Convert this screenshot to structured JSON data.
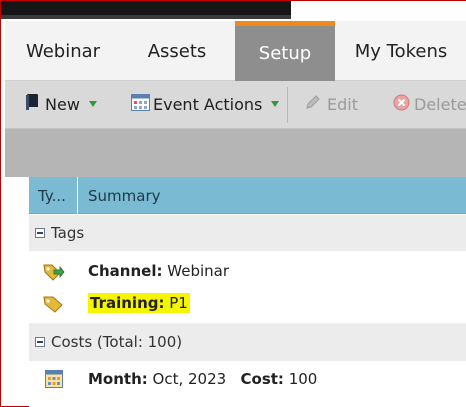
{
  "tabs": [
    {
      "label": "Webinar",
      "active": false
    },
    {
      "label": "Assets",
      "active": false
    },
    {
      "label": "Setup",
      "active": true
    },
    {
      "label": "My Tokens",
      "active": false
    }
  ],
  "toolbar": {
    "new_label": "New",
    "event_actions_label": "Event Actions",
    "edit_label": "Edit",
    "delete_label": "Delete"
  },
  "grid": {
    "columns": [
      "Ty...",
      "Summary"
    ],
    "groups": [
      {
        "label": "Tags",
        "rows": [
          {
            "icon": "tag-arrow-icon",
            "key": "Channel:",
            "value": "Webinar"
          },
          {
            "icon": "tag-icon",
            "key": "Training:",
            "value": "P1",
            "highlighted": true
          }
        ]
      },
      {
        "label": "Costs (Total: 100)",
        "rows": [
          {
            "icon": "calendar-icon",
            "key": "Month:",
            "value": "Oct, 2023",
            "key2": "Cost:",
            "value2": "100"
          }
        ]
      }
    ]
  },
  "colors": {
    "active_tab": "#8e8e8e",
    "active_tab_accent": "#f08a1c",
    "grid_header": "#7bbad3",
    "highlight": "#f5f500"
  }
}
